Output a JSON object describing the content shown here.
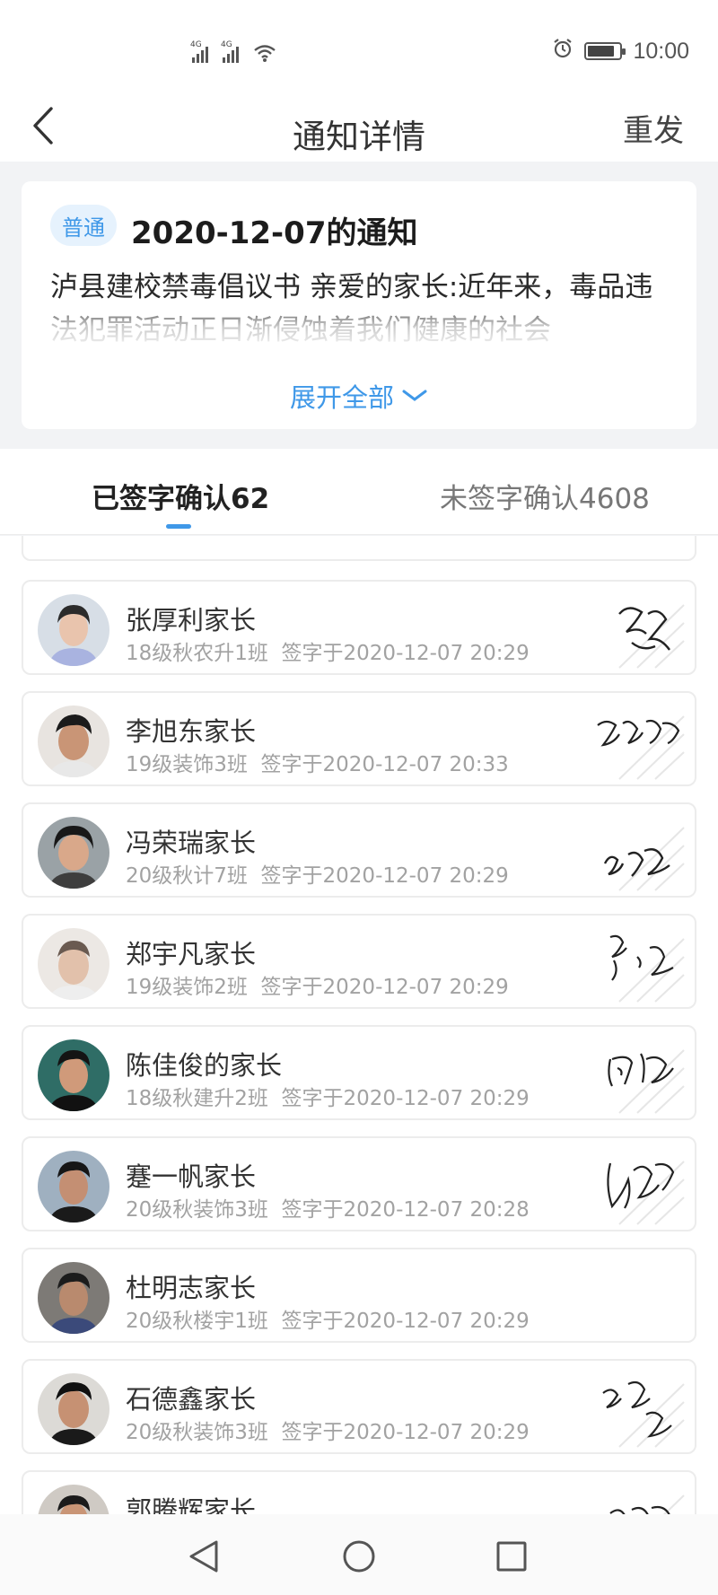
{
  "status_bar": {
    "time": "10:00",
    "signal_label": "4G",
    "battery_level": 0.85,
    "icons": [
      "signal-icon",
      "wifi-icon",
      "alarm-icon",
      "battery-icon"
    ]
  },
  "nav": {
    "title": "通知详情",
    "resend": "重发",
    "back_icon": "back-arrow-icon"
  },
  "notice": {
    "tag": "普通",
    "title": "2020-12-07的通知",
    "body": "泸县建校禁毒倡议书 亲爱的家长:近年来，毒品违法犯罪活动正日渐侵蚀着我们健康的社会",
    "expand_label": "展开全部"
  },
  "tabs": [
    {
      "label": "已签字确认62",
      "active": true
    },
    {
      "label": "未签字确认4608",
      "active": false
    }
  ],
  "signers": [
    {
      "name": "张厚利家长",
      "class": "18级秋农升1班",
      "signed_at": "签字于2020-12-07 20:29",
      "has_signature": true
    },
    {
      "name": "李旭东家长",
      "class": "19级装饰3班",
      "signed_at": "签字于2020-12-07 20:33",
      "has_signature": true
    },
    {
      "name": "冯荣瑞家长",
      "class": "20级秋计7班",
      "signed_at": "签字于2020-12-07 20:29",
      "has_signature": true
    },
    {
      "name": "郑宇凡家长",
      "class": "19级装饰2班",
      "signed_at": "签字于2020-12-07 20:29",
      "has_signature": true
    },
    {
      "name": "陈佳俊的家长",
      "class": "18级秋建升2班",
      "signed_at": "签字于2020-12-07 20:29",
      "has_signature": true
    },
    {
      "name": "蹇一帆家长",
      "class": "20级秋装饰3班",
      "signed_at": "签字于2020-12-07 20:28",
      "has_signature": true
    },
    {
      "name": "杜明志家长",
      "class": "20级秋楼宇1班",
      "signed_at": "签字于2020-12-07 20:29",
      "has_signature": false
    },
    {
      "name": "石德鑫家长",
      "class": "20级秋装饰3班",
      "signed_at": "签字于2020-12-07 20:29",
      "has_signature": true
    },
    {
      "name": "郭腾辉家长",
      "class": "",
      "signed_at": "",
      "has_signature": true
    }
  ],
  "colors": {
    "accent": "#3f98e8",
    "tag_bg": "#e6f2fd",
    "page_bg": "#f2f3f5"
  },
  "system_nav": {
    "icons": [
      "back-triangle-icon",
      "home-circle-icon",
      "recents-square-icon"
    ]
  }
}
